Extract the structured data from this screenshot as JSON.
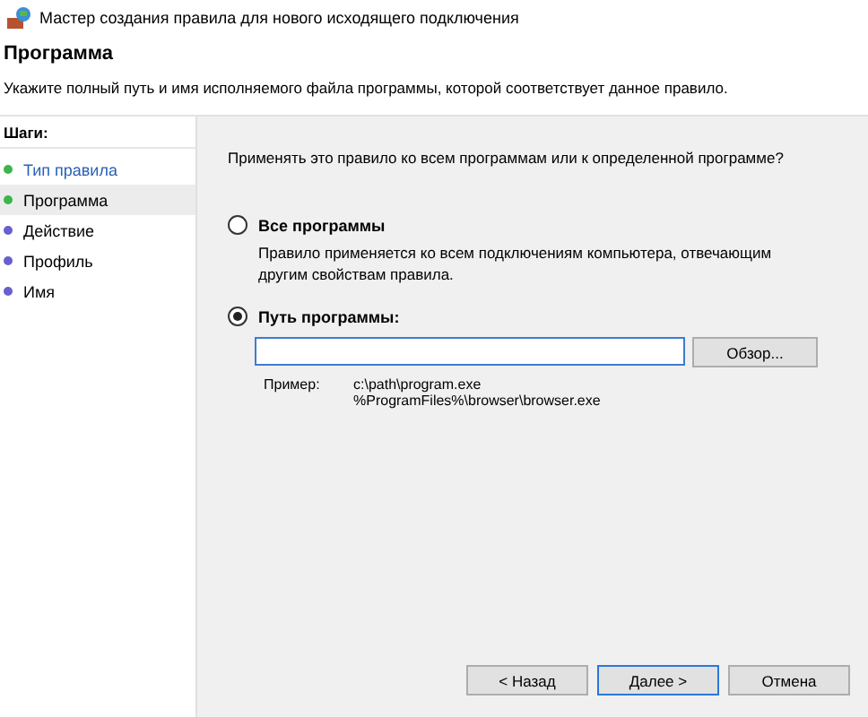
{
  "window": {
    "title": "Мастер создания правила для нового исходящего подключения"
  },
  "header": {
    "title": "Программа",
    "description": "Укажите полный путь и имя исполняемого файла программы, которой соответствует данное правило."
  },
  "sidebar": {
    "title": "Шаги:",
    "steps": [
      {
        "label": "Тип правила",
        "color": "#3cb54a",
        "selected": false
      },
      {
        "label": "Программа",
        "color": "#3cb54a",
        "selected": true
      },
      {
        "label": "Действие",
        "color": "#6a5fcf",
        "selected": false
      },
      {
        "label": "Профиль",
        "color": "#6a5fcf",
        "selected": false
      },
      {
        "label": "Имя",
        "color": "#6a5fcf",
        "selected": false
      }
    ]
  },
  "content": {
    "question": "Применять это правило ко всем программам или к определенной программе?",
    "options": [
      {
        "label": "Все программы",
        "description": "Правило применяется ко всем подключениям компьютера, отвечающим другим свойствам правила.",
        "selected": false
      },
      {
        "label": "Путь программы:",
        "selected": true
      }
    ],
    "path_field": {
      "focused": true
    },
    "browse_button": "Обзор...",
    "example_label": "Пример:",
    "examples": [
      "c:\\path\\program.exe",
      "%ProgramFiles%\\browser\\browser.exe"
    ]
  },
  "buttons": [
    {
      "label": "< Назад",
      "default": false
    },
    {
      "label": "Далее >",
      "default": true
    },
    {
      "label": "Отмена",
      "default": false
    }
  ]
}
